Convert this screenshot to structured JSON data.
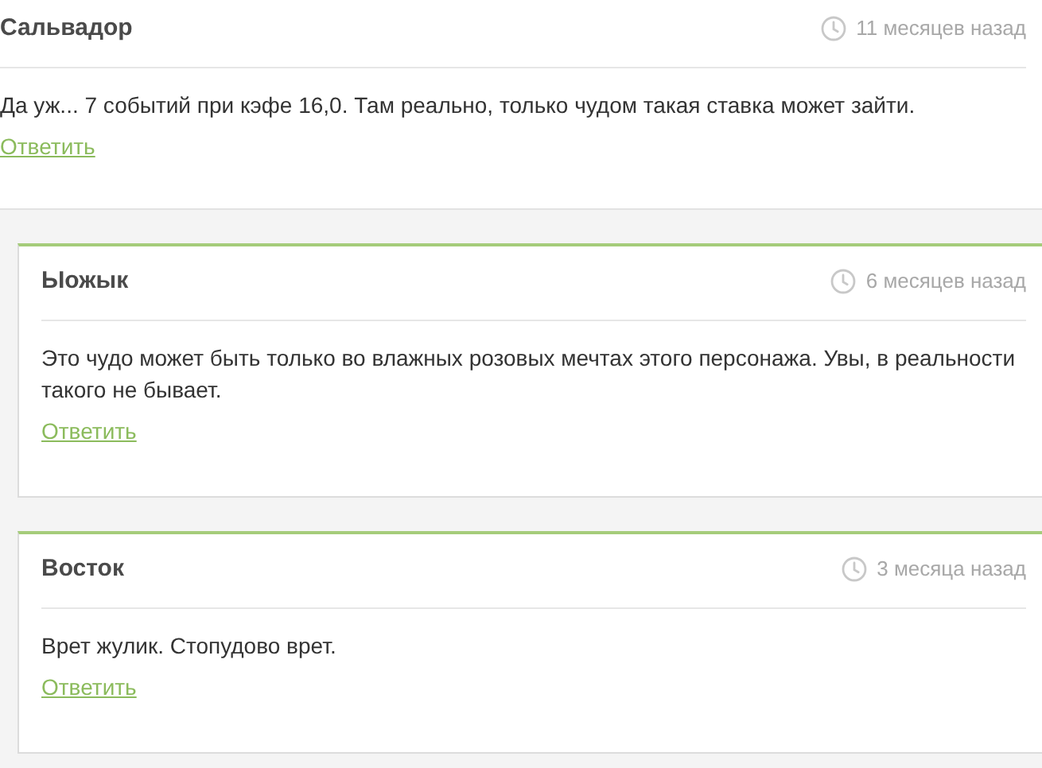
{
  "comments": [
    {
      "kind": "top",
      "author": "Сальвадор",
      "time": "11 месяцев назад",
      "text": "Да уж... 7 событий при кэфе 16,0. Там реально, только чудом такая ставка может зайти.",
      "reply_link": "Ответить"
    },
    {
      "kind": "reply",
      "author": "Ыожык",
      "time": "6 месяцев назад",
      "text": "Это чудо может быть только во влажных розовых мечтах этого персонажа. Увы, в реальности такого не бывает.",
      "reply_link": "Ответить"
    },
    {
      "kind": "reply",
      "author": "Восток",
      "time": "3 месяца назад",
      "text": "Врет жулик. Стопудово врет.",
      "reply_link": "Ответить"
    }
  ]
}
